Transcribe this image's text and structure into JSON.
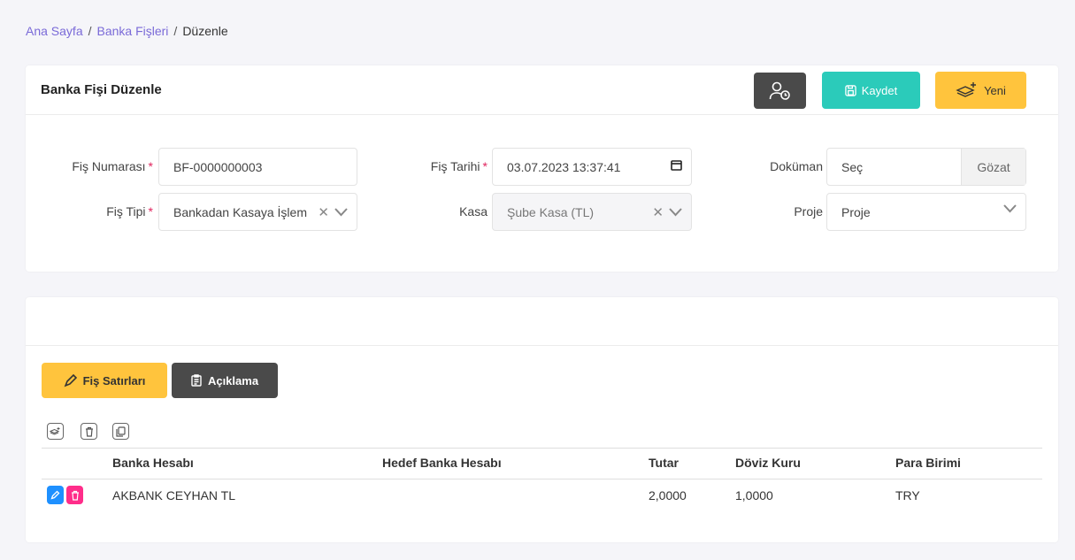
{
  "breadcrumb": {
    "home": "Ana Sayfa",
    "separator": "/",
    "parent": "Banka Fişleri",
    "current": "Düzenle"
  },
  "header": {
    "title": "Banka Fişi Düzenle",
    "history_icon": "user-clock-icon",
    "save_label": "Kaydet",
    "save_icon": "save-icon",
    "new_label": "Yeni",
    "new_icon": "layers-plus-icon"
  },
  "form": {
    "fis_numarasi": {
      "label": "Fiş Numarası",
      "required": "*",
      "value": "BF-0000000003"
    },
    "fis_tipi": {
      "label": "Fiş Tipi",
      "required": "*",
      "value": "Bankadan Kasaya İşlem"
    },
    "fis_tarihi": {
      "label": "Fiş Tarihi",
      "required": "*",
      "value": "03.07.2023 13:37:41"
    },
    "kasa": {
      "label": "Kasa",
      "value": "Şube Kasa (TL)"
    },
    "dokuman": {
      "label": "Doküman",
      "value": "Seç",
      "browse_label": "Gözat"
    },
    "proje": {
      "label": "Proje",
      "value": "Proje"
    }
  },
  "tabs": {
    "lines_label": "Fiş Satırları",
    "lines_icon": "pen-icon",
    "desc_label": "Açıklama",
    "desc_icon": "clipboard-icon"
  },
  "grid": {
    "columns": [
      "Banka Hesabı",
      "Hedef Banka Hesabı",
      "Tutar",
      "Döviz Kuru",
      "Para Birimi"
    ],
    "rows": [
      {
        "banka_hesabi": "AKBANK CEYHAN TL",
        "hedef_banka_hesabi": "",
        "tutar": "2,0000",
        "doviz_kuru": "1,0000",
        "para_birimi": "TRY"
      }
    ]
  },
  "colors": {
    "accent": "#7a6ad8",
    "save": "#2bcbba",
    "new": "#ffc43d",
    "dark": "#4a4a4a",
    "edit": "#1e90ff",
    "delete": "#ff2d8a"
  }
}
